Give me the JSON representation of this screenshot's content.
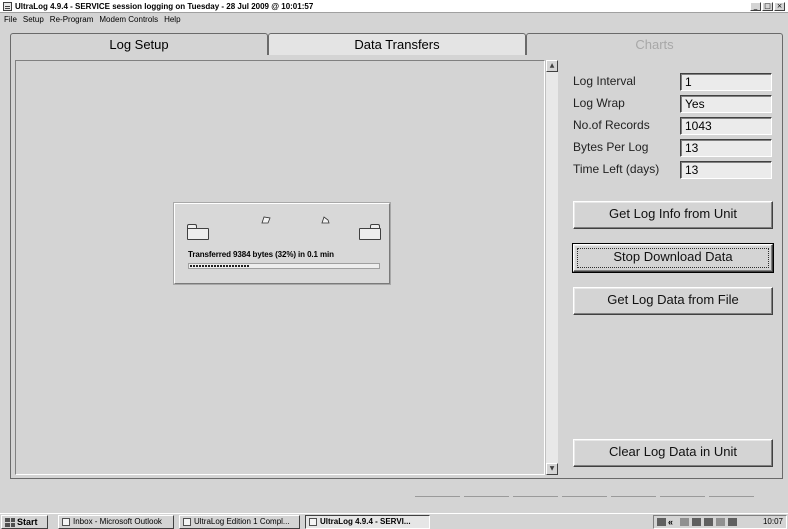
{
  "window": {
    "title": "UltraLog 4.9.4 - SERVICE session logging on Tuesday - 28 Jul 2009 @ 10:01:57",
    "controls": [
      "_",
      "□",
      "×"
    ]
  },
  "menu": [
    "File",
    "Setup",
    "Re-Program",
    "Modem Controls",
    "Help"
  ],
  "tabs": [
    {
      "label": "Log Setup",
      "state": "normal"
    },
    {
      "label": "Data Transfers",
      "state": "active"
    },
    {
      "label": "Charts",
      "state": "disabled"
    }
  ],
  "transfer": {
    "status_text": "Transferred 9384 bytes (32%) in 0.1 min",
    "progress_fraction": 0.32
  },
  "fields": [
    {
      "label": "Log Interval",
      "value": "1"
    },
    {
      "label": "Log Wrap",
      "value": "Yes"
    },
    {
      "label": "No.of Records",
      "value": "1043"
    },
    {
      "label": "Bytes Per Log",
      "value": "13"
    },
    {
      "label": "Time Left (days)",
      "value": "13"
    }
  ],
  "buttons": {
    "get_log_info": "Get Log Info from Unit",
    "stop_download": "Stop Download Data",
    "get_log_file": "Get Log Data from File",
    "clear_log": "Clear Log Data in Unit"
  },
  "scrollbar": {
    "up_arrow": "▲",
    "down_arrow": "▼"
  },
  "taskbar": {
    "start_label": "Start",
    "tasks": [
      {
        "label": "Inbox - Microsoft Outlook",
        "active": false
      },
      {
        "label": "UltraLog Edition 1 Compl...",
        "active": false
      },
      {
        "label": "UltraLog 4.9.4 - SERVI...",
        "active": true
      }
    ],
    "tray_chevron": "«",
    "clock": "10:07"
  },
  "colors": {
    "background": "#d4d4d4",
    "active_tab": "#e4e4e4",
    "disabled_text": "#a8a8a8"
  }
}
